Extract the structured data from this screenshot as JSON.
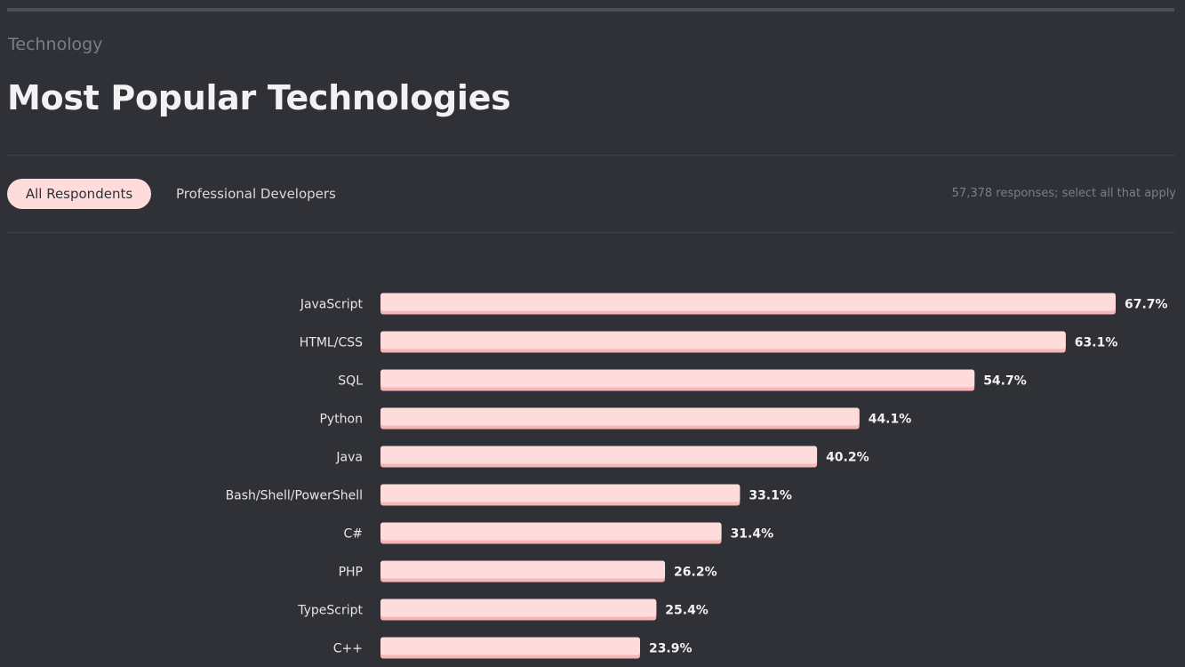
{
  "section": {
    "label": "Technology"
  },
  "title": "Most Popular Technologies",
  "tabs": [
    {
      "label": "All Respondents",
      "active": true
    },
    {
      "label": "Professional Developers",
      "active": false
    }
  ],
  "responses_note": "57,378 responses; select all that apply",
  "colors": {
    "background": "#2f3136",
    "bar": "#ffdcdc",
    "bar_shadow": "#f5b6b6",
    "tab_active_bg": "#ffdcdc"
  },
  "chart_data": {
    "type": "bar",
    "orientation": "horizontal",
    "title": "",
    "xlabel": "",
    "ylabel": "",
    "unit": "%",
    "xlim": [
      0,
      67.7
    ],
    "grid": false,
    "categories": [
      "JavaScript",
      "HTML/CSS",
      "SQL",
      "Python",
      "Java",
      "Bash/Shell/PowerShell",
      "C#",
      "PHP",
      "TypeScript",
      "C++"
    ],
    "values": [
      67.7,
      63.1,
      54.7,
      44.1,
      40.2,
      33.1,
      31.4,
      26.2,
      25.4,
      23.9
    ],
    "value_labels": [
      "67.7%",
      "63.1%",
      "54.7%",
      "44.1%",
      "40.2%",
      "33.1%",
      "31.4%",
      "26.2%",
      "25.4%",
      "23.9%"
    ]
  }
}
